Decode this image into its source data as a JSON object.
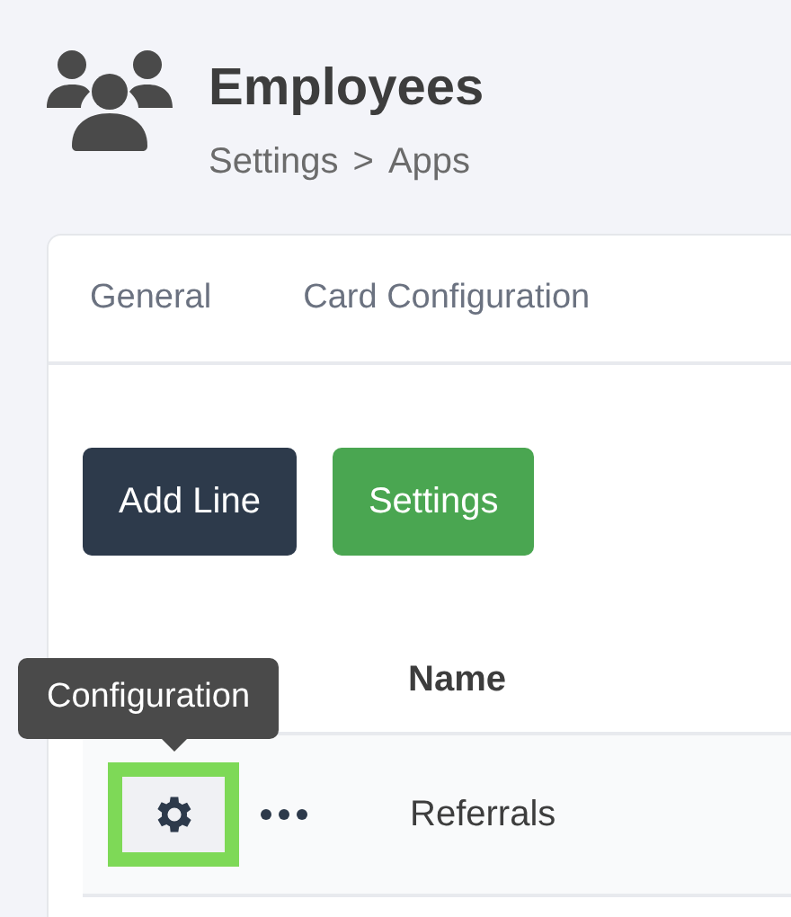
{
  "header": {
    "title": "Employees",
    "breadcrumb": [
      {
        "label": "Settings"
      },
      {
        "label": "Apps"
      }
    ],
    "separator": ">"
  },
  "tabs": [
    {
      "label": "General",
      "selected": false
    },
    {
      "label": "Card Configuration",
      "selected": false
    }
  ],
  "buttons": [
    {
      "label": "Add Line",
      "kind": "dark"
    },
    {
      "label": "Settings",
      "kind": "green"
    }
  ],
  "table": {
    "columns": [
      "Name"
    ],
    "rows": [
      {
        "name": "Referrals",
        "actions": [
          {
            "kind": "gear",
            "highlighted": true
          },
          {
            "kind": "more",
            "highlighted": false
          }
        ]
      }
    ]
  },
  "tooltip": {
    "text": "Configuration"
  }
}
